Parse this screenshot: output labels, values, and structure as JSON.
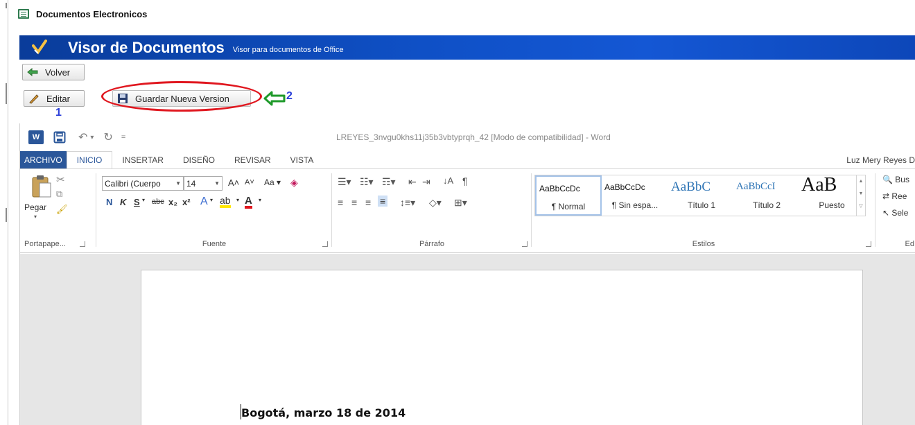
{
  "window": {
    "title": "Documentos Electronicos"
  },
  "banner": {
    "title": "Visor de Documentos",
    "subtitle": "Visor para documentos de Office"
  },
  "viewer": {
    "back_label": "Volver",
    "edit_label": "Editar",
    "save_version_label": "Guardar Nueva Version",
    "annotation_1": "1",
    "annotation_2": "2"
  },
  "word": {
    "doc_title": "LREYES_3nvgu0khs11j35b3vbtyprqh_42 [Modo de compatibilidad] - Word",
    "tabs": [
      "ARCHIVO",
      "INICIO",
      "INSERTAR",
      "DISEÑO",
      "REVISAR",
      "VISTA"
    ],
    "active_tab": "INICIO",
    "user": "Luz Mery Reyes D",
    "clipboard": {
      "paste_label": "Pegar",
      "group_label": "Portapape..."
    },
    "font": {
      "family": "Calibri (Cuerpo",
      "size": "14",
      "group_label": "Fuente",
      "bold": "N",
      "italic": "K",
      "underline": "S"
    },
    "paragraph": {
      "group_label": "Párrafo"
    },
    "styles": {
      "group_label": "Estilos",
      "items": [
        {
          "sample": "AaBbCcDc",
          "name": "¶ Normal"
        },
        {
          "sample": "AaBbCcDc",
          "name": "¶ Sin espa..."
        },
        {
          "sample": "AaBbC",
          "name": "Título 1"
        },
        {
          "sample": "AaBbCcI",
          "name": "Título 2"
        },
        {
          "sample": "AaB",
          "name": "Puesto"
        }
      ]
    },
    "editing": {
      "find": "Bus",
      "replace": "Ree",
      "select": "Sele",
      "group_label": "Ed"
    },
    "document_text": "Bogotá, marzo 18 de 2014"
  },
  "colors": {
    "accent_blue": "#2b579a",
    "banner_blue": "#0f50c6",
    "annotation_red": "#e0171f",
    "annotation_green": "#1e9a2a",
    "annotation_number": "#2b3fd9"
  }
}
